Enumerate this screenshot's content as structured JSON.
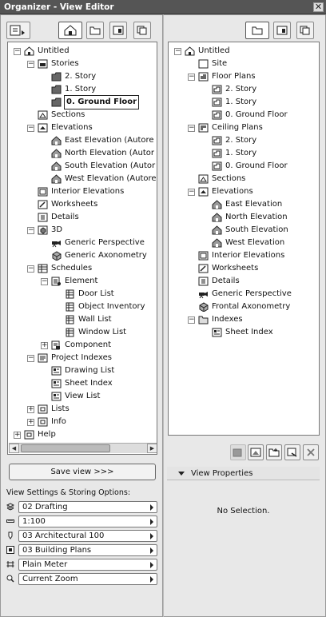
{
  "window": {
    "title": "Organizer - View Editor",
    "close_glyph": "✕"
  },
  "left_panel": {
    "tree": [
      {
        "label": "Untitled",
        "icon": "project-icon"
      },
      {
        "label": "Stories",
        "icon": "stories-icon"
      },
      {
        "label": "2. Story",
        "icon": "story-icon"
      },
      {
        "label": "1. Story",
        "icon": "story-icon"
      },
      {
        "label": "0. Ground Floor",
        "icon": "story-icon",
        "selected": true
      },
      {
        "label": "Sections",
        "icon": "section-icon"
      },
      {
        "label": "Elevations",
        "icon": "elevation-icon"
      },
      {
        "label": "East Elevation (Autore",
        "icon": "elevation-view-icon"
      },
      {
        "label": "North Elevation (Autor",
        "icon": "elevation-view-icon"
      },
      {
        "label": "South Elevation (Autor",
        "icon": "elevation-view-icon"
      },
      {
        "label": "West Elevation (Autore",
        "icon": "elevation-view-icon"
      },
      {
        "label": "Interior Elevations",
        "icon": "interior-elevation-icon"
      },
      {
        "label": "Worksheets",
        "icon": "worksheet-icon"
      },
      {
        "label": "Details",
        "icon": "detail-icon"
      },
      {
        "label": "3D",
        "icon": "3d-icon"
      },
      {
        "label": "Generic Perspective",
        "icon": "camera-icon"
      },
      {
        "label": "Generic Axonometry",
        "icon": "axonometry-icon"
      },
      {
        "label": "Schedules",
        "icon": "schedules-icon"
      },
      {
        "label": "Element",
        "icon": "element-icon"
      },
      {
        "label": "Door List",
        "icon": "list-icon"
      },
      {
        "label": "Object Inventory",
        "icon": "list-icon"
      },
      {
        "label": "Wall List",
        "icon": "list-icon"
      },
      {
        "label": "Window List",
        "icon": "list-icon"
      },
      {
        "label": "Component",
        "icon": "component-icon"
      },
      {
        "label": "Project Indexes",
        "icon": "project-index-icon"
      },
      {
        "label": "Drawing List",
        "icon": "index-list-icon"
      },
      {
        "label": "Sheet Index",
        "icon": "index-list-icon"
      },
      {
        "label": "View List",
        "icon": "index-list-icon"
      },
      {
        "label": "Lists",
        "icon": "lists-icon"
      },
      {
        "label": "Info",
        "icon": "info-icon"
      },
      {
        "label": "Help",
        "icon": "help-icon"
      }
    ],
    "save_view_label": "Save view >>>",
    "options_title": "View Settings & Storing Options:",
    "options": [
      {
        "name": "layer-combination",
        "icon": "layers-icon",
        "value": "02 Drafting"
      },
      {
        "name": "scale",
        "icon": "scale-icon",
        "value": "1:100"
      },
      {
        "name": "pen-set",
        "icon": "pen-icon",
        "value": "03 Architectural 100"
      },
      {
        "name": "model-view-options",
        "icon": "model-view-icon",
        "value": "03 Building Plans"
      },
      {
        "name": "dimensions",
        "icon": "dimension-icon",
        "value": "Plain Meter"
      },
      {
        "name": "zoom",
        "icon": "zoom-icon",
        "value": "Current Zoom"
      }
    ]
  },
  "right_panel": {
    "tree": [
      {
        "label": "Untitled",
        "icon": "project-icon"
      },
      {
        "label": "Site",
        "icon": "site-icon"
      },
      {
        "label": "Floor Plans",
        "icon": "floor-plans-icon"
      },
      {
        "label": "2. Story",
        "icon": "floor-plan-icon"
      },
      {
        "label": "1. Story",
        "icon": "floor-plan-icon"
      },
      {
        "label": "0. Ground Floor",
        "icon": "floor-plan-icon"
      },
      {
        "label": "Ceiling Plans",
        "icon": "ceiling-plans-icon"
      },
      {
        "label": "2. Story",
        "icon": "floor-plan-icon"
      },
      {
        "label": "1. Story",
        "icon": "floor-plan-icon"
      },
      {
        "label": "0. Ground Floor",
        "icon": "floor-plan-icon"
      },
      {
        "label": "Sections",
        "icon": "section-icon"
      },
      {
        "label": "Elevations",
        "icon": "elevation-icon"
      },
      {
        "label": "East Elevation",
        "icon": "elevation-view-icon"
      },
      {
        "label": "North Elevation",
        "icon": "elevation-view-icon"
      },
      {
        "label": "South Elevation",
        "icon": "elevation-view-icon"
      },
      {
        "label": "West Elevation",
        "icon": "elevation-view-icon"
      },
      {
        "label": "Interior Elevations",
        "icon": "interior-elevation-icon"
      },
      {
        "label": "Worksheets",
        "icon": "worksheet-icon"
      },
      {
        "label": "Details",
        "icon": "detail-icon"
      },
      {
        "label": "Generic Perspective",
        "icon": "camera-icon"
      },
      {
        "label": "Frontal Axonometry",
        "icon": "axonometry-icon"
      },
      {
        "label": "Indexes",
        "icon": "folder-icon"
      },
      {
        "label": "Sheet Index",
        "icon": "index-list-icon"
      }
    ],
    "view_properties_label": "View Properties",
    "no_selection": "No Selection."
  }
}
